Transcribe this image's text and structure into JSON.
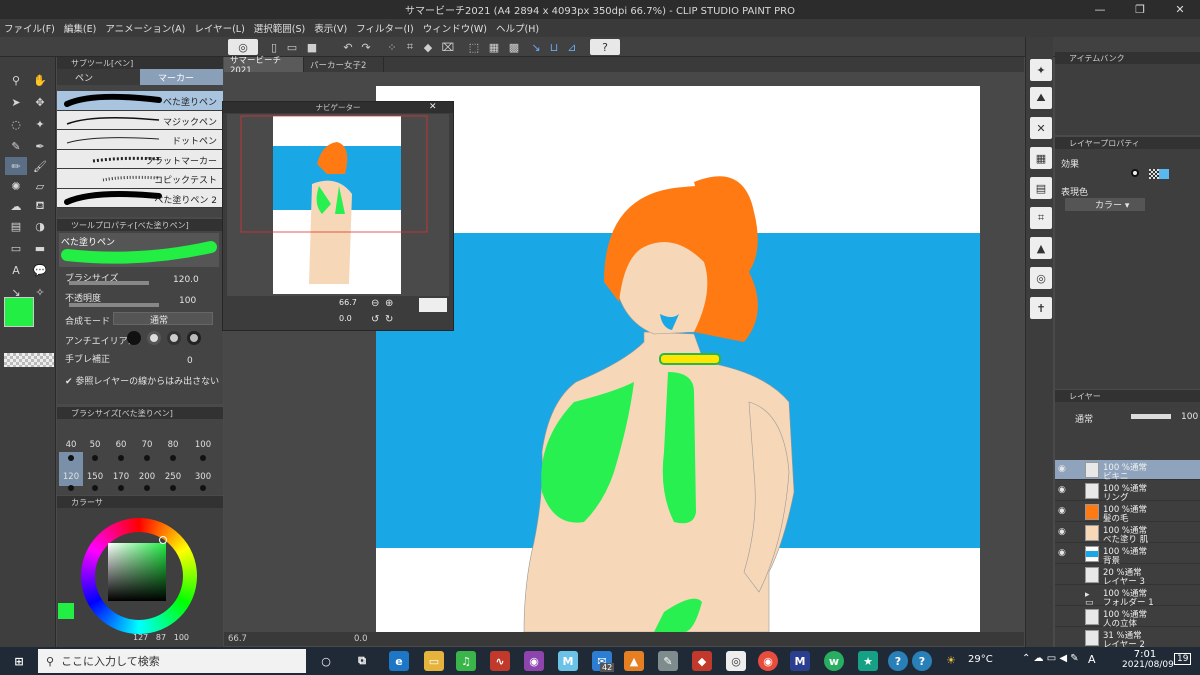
{
  "window": {
    "title": "サマービーチ2021 (A4 2894 x 4093px 350dpi 66.7%) - CLIP STUDIO PAINT PRO",
    "minimize": "—",
    "maximize": "❐",
    "close": "✕"
  },
  "menu": [
    "ファイル(F)",
    "編集(E)",
    "アニメーション(A)",
    "レイヤー(L)",
    "選択範囲(S)",
    "表示(V)",
    "フィルター(I)",
    "ウィンドウ(W)",
    "ヘルプ(H)"
  ],
  "doc_tabs": [
    "サマービーチ2021",
    "パーカー女子2"
  ],
  "subtool": {
    "header": "サブツール[ペン]",
    "tabs": [
      "ペン",
      "マーカー"
    ],
    "brushes": [
      "べた塗りペン",
      "マジックペン",
      "ドットペン",
      "フラットマーカー",
      "コピックテスト",
      "べた塗りペン 2"
    ]
  },
  "toolprop": {
    "header": "ツールプロパティ[べた塗りペン]",
    "brush_name": "べた塗りペン",
    "brush_size_label": "ブラシサイズ",
    "brush_size_value": "120.0",
    "opacity_label": "不透明度",
    "opacity_value": "100",
    "blend_label": "合成モード",
    "blend_value": "通常",
    "antialias_label": "アンチエイリアス",
    "stabilize_label": "手ブレ補正",
    "stabilize_value": "0",
    "ref_layer_label": "参照レイヤーの線からはみ出さない"
  },
  "brushsize_panel": {
    "header": "ブラシサイズ[べた塗りペン]",
    "row1": [
      "40",
      "50",
      "60",
      "70",
      "80",
      "100"
    ],
    "row2": [
      "120",
      "150",
      "170",
      "200",
      "250",
      "300"
    ]
  },
  "color_panel": {
    "header": "カラーサ",
    "readout": [
      "127",
      "87",
      "100"
    ]
  },
  "navigator": {
    "title": "ナビゲーター",
    "zoom": "66.7",
    "angle": "0.0"
  },
  "status": {
    "zoom": "66.7",
    "angle": "0.0"
  },
  "itembank": {
    "header": "アイテムバンク"
  },
  "layerprop": {
    "header": "レイヤープロパティ",
    "effect_label": "効果",
    "expression_label": "表現色",
    "expression_value": "カラー"
  },
  "layerpanel": {
    "header": "レイヤー",
    "blend": "通常",
    "opacity": "100",
    "layers": [
      {
        "l1": "100 %通常",
        "l2": "ビキニ"
      },
      {
        "l1": "100 %通常",
        "l2": "リング"
      },
      {
        "l1": "100 %通常",
        "l2": "髪の毛"
      },
      {
        "l1": "100 %通常",
        "l2": "べた塗り 肌"
      },
      {
        "l1": "100 %通常",
        "l2": "背景"
      },
      {
        "l1": "20 %通常",
        "l2": "レイヤー 3"
      },
      {
        "l1": "100 %通常",
        "l2": "フォルダー 1"
      },
      {
        "l1": "100 %通常",
        "l2": "人の立体"
      },
      {
        "l1": "31 %通常",
        "l2": "レイヤー 2"
      }
    ]
  },
  "taskbar": {
    "search_placeholder": "ここに入力して検索",
    "mail_badge": "42",
    "temperature": "29°C",
    "ime": "A",
    "time": "7:01",
    "date": "2021/08/09",
    "notif_count": "19"
  },
  "colors": {
    "main_color": "#22ee44",
    "sub_color": "#000000",
    "sky_blue": "#1aa7e6",
    "hair_orange": "#ff7a12",
    "skin": "#f6d8b8",
    "bikini_green": "#28f050"
  }
}
